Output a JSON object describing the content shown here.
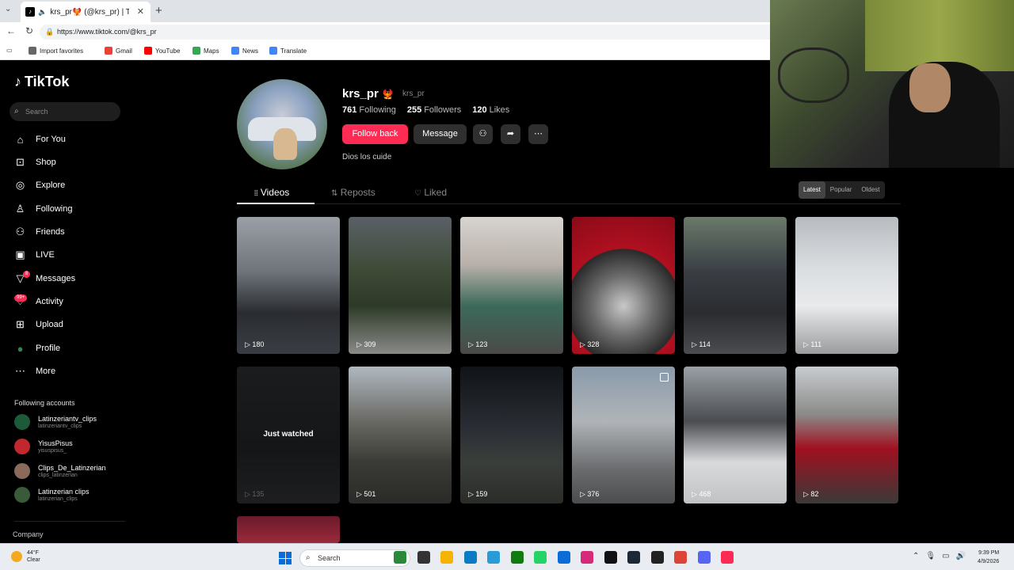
{
  "browser": {
    "tab_title": "krs_pr🐦‍🔥 (@krs_pr) | TikTok",
    "tab_icon": "tiktok-icon",
    "url": "https://www.tiktok.com/@krs_pr",
    "favorites": [
      {
        "label": "Import favorites",
        "icon": "import-icon",
        "color": "#666666"
      },
      {
        "label": "Gmail",
        "icon": "google-icon",
        "color": "#ea4335"
      },
      {
        "label": "YouTube",
        "icon": "youtube-icon",
        "color": "#ff0000"
      },
      {
        "label": "Maps",
        "icon": "maps-icon",
        "color": "#34a853"
      },
      {
        "label": "News",
        "icon": "news-icon",
        "color": "#4285f4"
      },
      {
        "label": "Translate",
        "icon": "translate-icon",
        "color": "#4285f4"
      }
    ]
  },
  "sidebar": {
    "logo": "TikTok",
    "search_placeholder": "Search",
    "nav": [
      {
        "label": "For You",
        "icon": "home-icon"
      },
      {
        "label": "Shop",
        "icon": "shop-icon"
      },
      {
        "label": "Explore",
        "icon": "compass-icon"
      },
      {
        "label": "Following",
        "icon": "following-icon"
      },
      {
        "label": "Friends",
        "icon": "friends-icon"
      },
      {
        "label": "LIVE",
        "icon": "live-icon"
      },
      {
        "label": "Messages",
        "icon": "messages-icon",
        "badge": "8"
      },
      {
        "label": "Activity",
        "icon": "activity-icon",
        "badge": "99+"
      },
      {
        "label": "Upload",
        "icon": "upload-icon"
      },
      {
        "label": "Profile",
        "icon": "profile-icon"
      },
      {
        "label": "More",
        "icon": "more-icon"
      }
    ],
    "following_title": "Following accounts",
    "accounts": [
      {
        "name": "Latinzeriantv_clips",
        "handle": "latinzeriantv_clips",
        "color": "#1c5a3a"
      },
      {
        "name": "YisusPisus",
        "handle": "yisuspisus_",
        "color": "#c0282d"
      },
      {
        "name": "Clips_De_Latinzerian",
        "handle": "clips_latinzerian",
        "color": "#8a6a5a"
      },
      {
        "name": "Latinzerian clips",
        "handle": "latinzerian_clips",
        "color": "#3a5a3a"
      }
    ],
    "company": "Company"
  },
  "profile": {
    "username": "krs_pr",
    "username_emoji": "🐦‍🔥",
    "nickname": "krs_pr",
    "following_count": "761",
    "following_label": "Following",
    "followers_count": "255",
    "followers_label": "Followers",
    "likes_count": "120",
    "likes_label": "Likes",
    "follow_back": "Follow back",
    "message": "Message",
    "bio": "Dios los cuide"
  },
  "tabs": {
    "videos": "Videos",
    "reposts": "Reposts",
    "liked": "Liked"
  },
  "sort": {
    "latest": "Latest",
    "popular": "Popular",
    "oldest": "Oldest"
  },
  "videos": [
    {
      "views": "180",
      "bg": "linear-gradient(180deg,#9aa0a6 0%,#6e747a 40%,#2a2c30 70%,#3a3e44 100%)"
    },
    {
      "views": "309",
      "bg": "linear-gradient(180deg,#5a6066 0%,#3e4a36 40%,#2e3a28 65%,#8a8a88 100%)"
    },
    {
      "views": "123",
      "bg": "linear-gradient(180deg,#d8d4d0 0%,#b8b0aa 35%,#3c6a5a 65%,#4a4a48 100%)"
    },
    {
      "views": "328",
      "bg": "radial-gradient(circle at 50% 65%,#c8c8c8 0%,#6a6a6a 30%,#2a2a2a 55%,#b01020 56%,#8a0a18 100%)"
    },
    {
      "views": "114",
      "bg": "linear-gradient(180deg,#6a7a6a 0%,#3a3e44 40%,#2a2c30 70%,#4a4c50 100%)"
    },
    {
      "views": "111",
      "bg": "linear-gradient(180deg,#b8bcc0 0%,#dcdfe2 40%,#e8eaec 65%,#9a9c9e 100%)"
    },
    {
      "views": "135",
      "bg": "linear-gradient(180deg,#1a1c1e 0%,#141618 60%,#1e1e20 100%)",
      "just_watched": true
    },
    {
      "views": "501",
      "bg": "linear-gradient(180deg,#b0b8c0 0%,#6a6a64 40%,#3a3a36 70%,#2a2a28 100%)"
    },
    {
      "views": "159",
      "bg": "linear-gradient(180deg,#101418 0%,#2a2e34 45%,#3a3e3a 70%,#2a2c28 100%)"
    },
    {
      "views": "376",
      "bg": "linear-gradient(180deg,#8a9aaa 0%,#b0b4b8 40%,#6a6c6e 75%,#4a4c4e 100%)",
      "multi": true
    },
    {
      "views": "468",
      "bg": "linear-gradient(180deg,#9aa0a6 0%,#4a4c50 40%,#d8dadc 70%,#c0c2c4 100%)"
    },
    {
      "views": "82",
      "bg": "linear-gradient(180deg,#c8ccd0 0%,#8a8a88 35%,#a01020 60%,#3a3a38 100%)"
    },
    {
      "views": "",
      "bg": "linear-gradient(180deg,#6a1a2a 0%,#9a2a3a 100%)"
    }
  ],
  "just_watched_label": "Just watched",
  "taskbar": {
    "temp": "44°F",
    "condition": "Clear",
    "search": "Search",
    "time": "9:39 PM",
    "date": "4/9/2026",
    "apps": [
      {
        "icon": "widgets-icon",
        "color": "#2a8a3a"
      },
      {
        "icon": "task-view-icon",
        "color": "#333333"
      },
      {
        "icon": "file-explorer-icon",
        "color": "#f4b400"
      },
      {
        "icon": "edge-icon",
        "color": "#0a7cc4"
      },
      {
        "icon": "mail-icon",
        "color": "#2a9ad8"
      },
      {
        "icon": "xbox-icon",
        "color": "#107c10"
      },
      {
        "icon": "whatsapp-icon",
        "color": "#25d366"
      },
      {
        "icon": "store-icon",
        "color": "#0a6cd8"
      },
      {
        "icon": "instagram-icon",
        "color": "#d6297a"
      },
      {
        "icon": "tiktok-icon",
        "color": "#111111"
      },
      {
        "icon": "steam-icon",
        "color": "#1b2838"
      },
      {
        "icon": "obs-icon",
        "color": "#222222"
      },
      {
        "icon": "chrome-icon",
        "color": "#db4437"
      },
      {
        "icon": "discord-icon",
        "color": "#5865f2"
      },
      {
        "icon": "tiktok-app-icon",
        "color": "#fe2c55"
      }
    ]
  }
}
